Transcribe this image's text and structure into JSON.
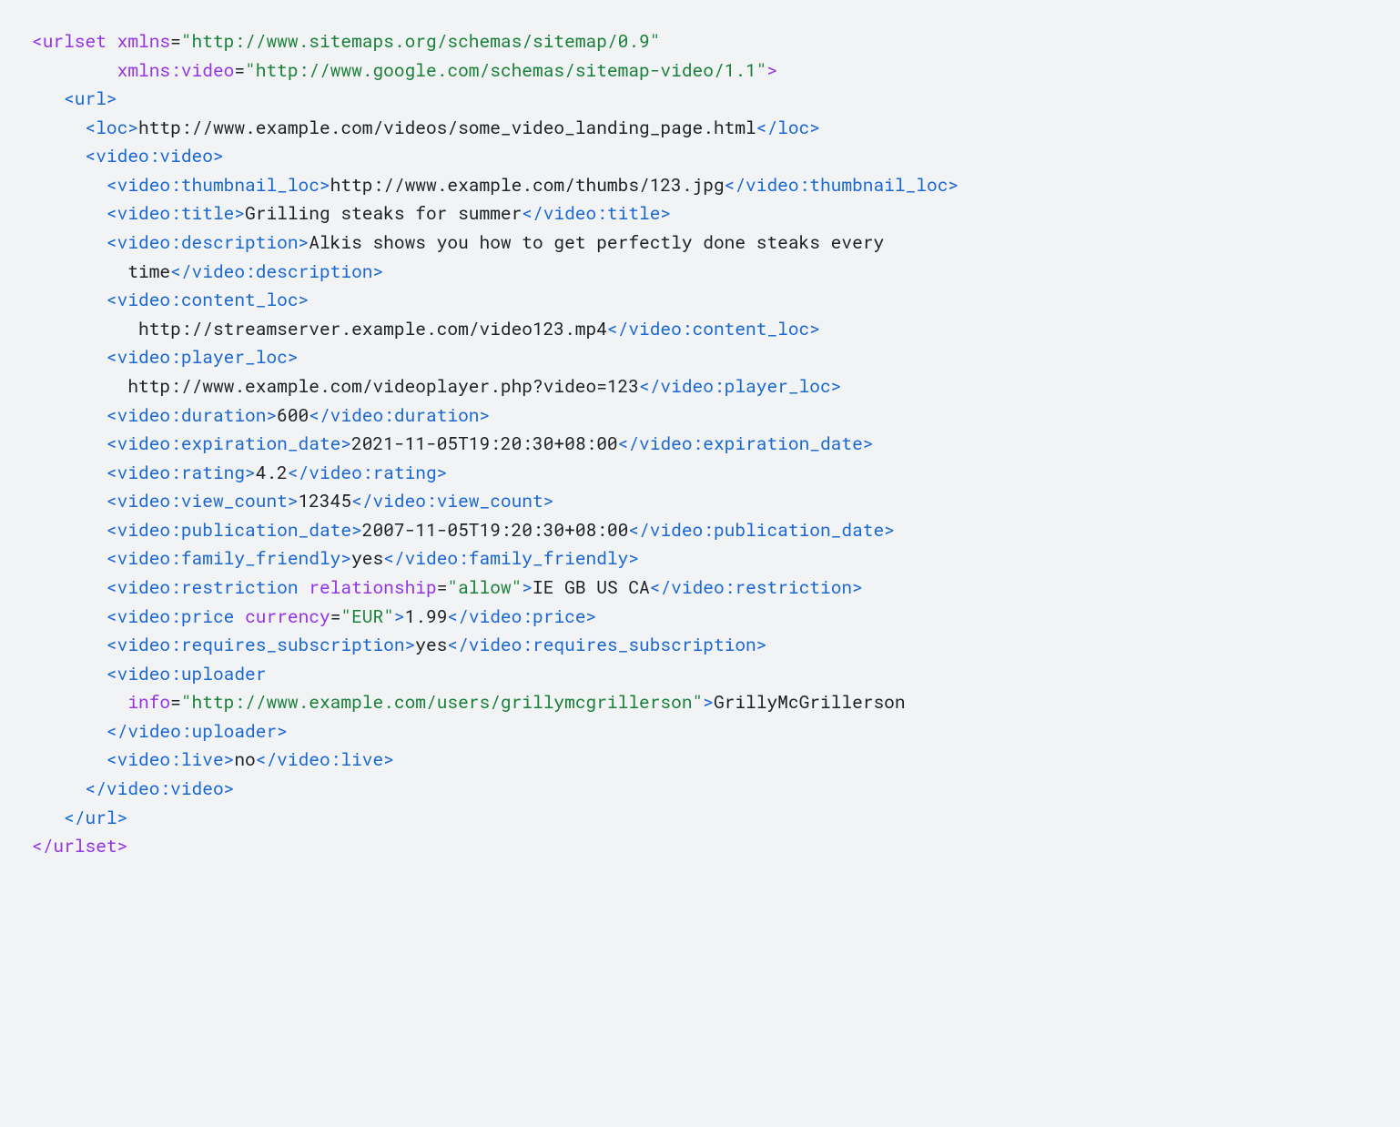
{
  "root_open": "<urlset",
  "root_close": "</urlset>",
  "xmlns_attr": "xmlns",
  "xmlns_val": "\"http://www.sitemaps.org/schemas/sitemap/0.9\"",
  "xmlns_video_attr": "xmlns:video",
  "xmlns_video_val": "\"http://www.google.com/schemas/sitemap-video/1.1\"",
  "gt": ">",
  "url_open": "<url>",
  "url_close": "</url>",
  "loc_open": "<loc>",
  "loc_val": "http://www.example.com/videos/some_video_landing_page.html",
  "loc_close": "</loc>",
  "video_open": "<video:video>",
  "video_close": "</video:video>",
  "thumb_open": "<video:thumbnail_loc>",
  "thumb_val": "http://www.example.com/thumbs/123.jpg",
  "thumb_close": "</video:thumbnail_loc>",
  "title_open": "<video:title>",
  "title_val": "Grilling steaks for summer",
  "title_close": "</video:title>",
  "desc_open": "<video:description>",
  "desc_val1": "Alkis shows you how to get perfectly done steaks every",
  "desc_val2": "time",
  "desc_close": "</video:description>",
  "content_open": "<video:content_loc>",
  "content_val": "http://streamserver.example.com/video123.mp4",
  "content_close": "</video:content_loc>",
  "player_open": "<video:player_loc>",
  "player_val": "http://www.example.com/videoplayer.php?video=123",
  "player_close": "</video:player_loc>",
  "duration_open": "<video:duration>",
  "duration_val": "600",
  "duration_close": "</video:duration>",
  "exp_open": "<video:expiration_date>",
  "exp_val": "2021-11-05T19:20:30+08:00",
  "exp_close": "</video:expiration_date>",
  "rating_open": "<video:rating>",
  "rating_val": "4.2",
  "rating_close": "</video:rating>",
  "views_open": "<video:view_count>",
  "views_val": "12345",
  "views_close": "</video:view_count>",
  "pub_open": "<video:publication_date>",
  "pub_val": "2007-11-05T19:20:30+08:00",
  "pub_close": "</video:publication_date>",
  "fam_open": "<video:family_friendly>",
  "fam_val": "yes",
  "fam_close": "</video:family_friendly>",
  "restr_open": "<video:restriction",
  "restr_attr": "relationship",
  "restr_attrval": "\"allow\"",
  "restr_val": "IE GB US CA",
  "restr_close": "</video:restriction>",
  "price_open": "<video:price",
  "price_attr": "currency",
  "price_attrval": "\"EUR\"",
  "price_val": "1.99",
  "price_close": "</video:price>",
  "sub_open": "<video:requires_subscription>",
  "sub_val": "yes",
  "sub_close": "</video:requires_subscription>",
  "up_open": "<video:uploader",
  "up_attr": "info",
  "up_attrval": "\"http://www.example.com/users/grillymcgrillerson\"",
  "up_val": "GrillyMcGrillerson",
  "up_close": "</video:uploader>",
  "live_open": "<video:live>",
  "live_val": "no",
  "live_close": "</video:live>"
}
